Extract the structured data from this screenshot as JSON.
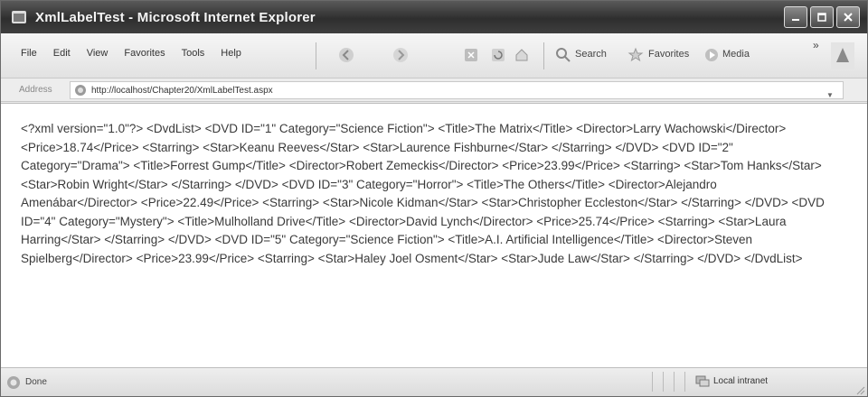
{
  "window": {
    "title": "XmlLabelTest - Microsoft Internet Explorer"
  },
  "menu": {
    "items": [
      "File",
      "Edit",
      "View",
      "Favorites",
      "Tools",
      "Help"
    ]
  },
  "toolbar": {
    "search_label": "Search",
    "favorites_label": "Favorites",
    "media_label": "Media",
    "chevron": "»"
  },
  "address": {
    "label": "Address",
    "url": "http://localhost/Chapter20/XmlLabelTest.aspx"
  },
  "content": {
    "xml": "<?xml version=\"1.0\"?> <DvdList> <DVD ID=\"1\" Category=\"Science Fiction\"> <Title>The Matrix</Title> <Director>Larry Wachowski</Director> <Price>18.74</Price> <Starring> <Star>Keanu Reeves</Star> <Star>Laurence Fishburne</Star> </Starring> </DVD> <DVD ID=\"2\" Category=\"Drama\"> <Title>Forrest Gump</Title> <Director>Robert Zemeckis</Director> <Price>23.99</Price> <Starring> <Star>Tom Hanks</Star> <Star>Robin Wright</Star> </Starring> </DVD> <DVD ID=\"3\" Category=\"Horror\"> <Title>The Others</Title> <Director>Alejandro Amenábar</Director> <Price>22.49</Price> <Starring> <Star>Nicole Kidman</Star> <Star>Christopher Eccleston</Star> </Starring> </DVD> <DVD ID=\"4\" Category=\"Mystery\"> <Title>Mulholland Drive</Title> <Director>David Lynch</Director> <Price>25.74</Price> <Starring> <Star>Laura Harring</Star> </Starring> </DVD> <DVD ID=\"5\" Category=\"Science Fiction\"> <Title>A.I. Artificial Intelligence</Title> <Director>Steven Spielberg</Director> <Price>23.99</Price> <Starring> <Star>Haley Joel Osment</Star> <Star>Jude Law</Star> </Starring> </DVD> </DvdList>"
  },
  "status": {
    "text": "Done",
    "zone": "Local intranet"
  },
  "icons": {
    "app": "ie-logo-icon",
    "back": "back-arrow-icon",
    "forward": "forward-arrow-icon",
    "stop": "stop-icon",
    "refresh": "refresh-icon",
    "home": "home-icon",
    "search": "search-icon",
    "favorites": "favorites-star-icon",
    "media": "media-icon"
  }
}
